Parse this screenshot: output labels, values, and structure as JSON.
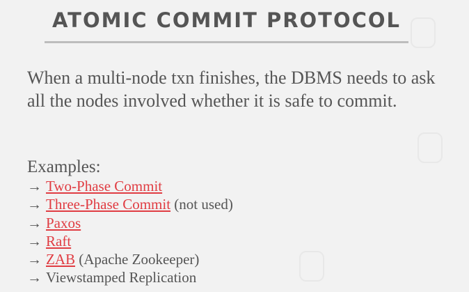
{
  "title": "ATOMIC COMMIT PROTOCOL",
  "body": "When a multi-node txn finishes, the DBMS needs to ask all the nodes involved whether it is safe to commit.",
  "examples_heading": "Examples:",
  "arrow": "→",
  "examples": [
    {
      "link": "Two-Phase Commit",
      "note": ""
    },
    {
      "link": "Three-Phase Commit",
      "note": "(not used)"
    },
    {
      "link": "Paxos",
      "note": ""
    },
    {
      "link": "Raft",
      "note": ""
    },
    {
      "link": "ZAB",
      "note": "(Apache Zookeeper)"
    },
    {
      "link": "",
      "text": "Viewstamped Replication"
    }
  ],
  "colors": {
    "background": "#f2f2f2",
    "text": "#555555",
    "link": "#e03c42",
    "rule": "#bdbdbd"
  }
}
